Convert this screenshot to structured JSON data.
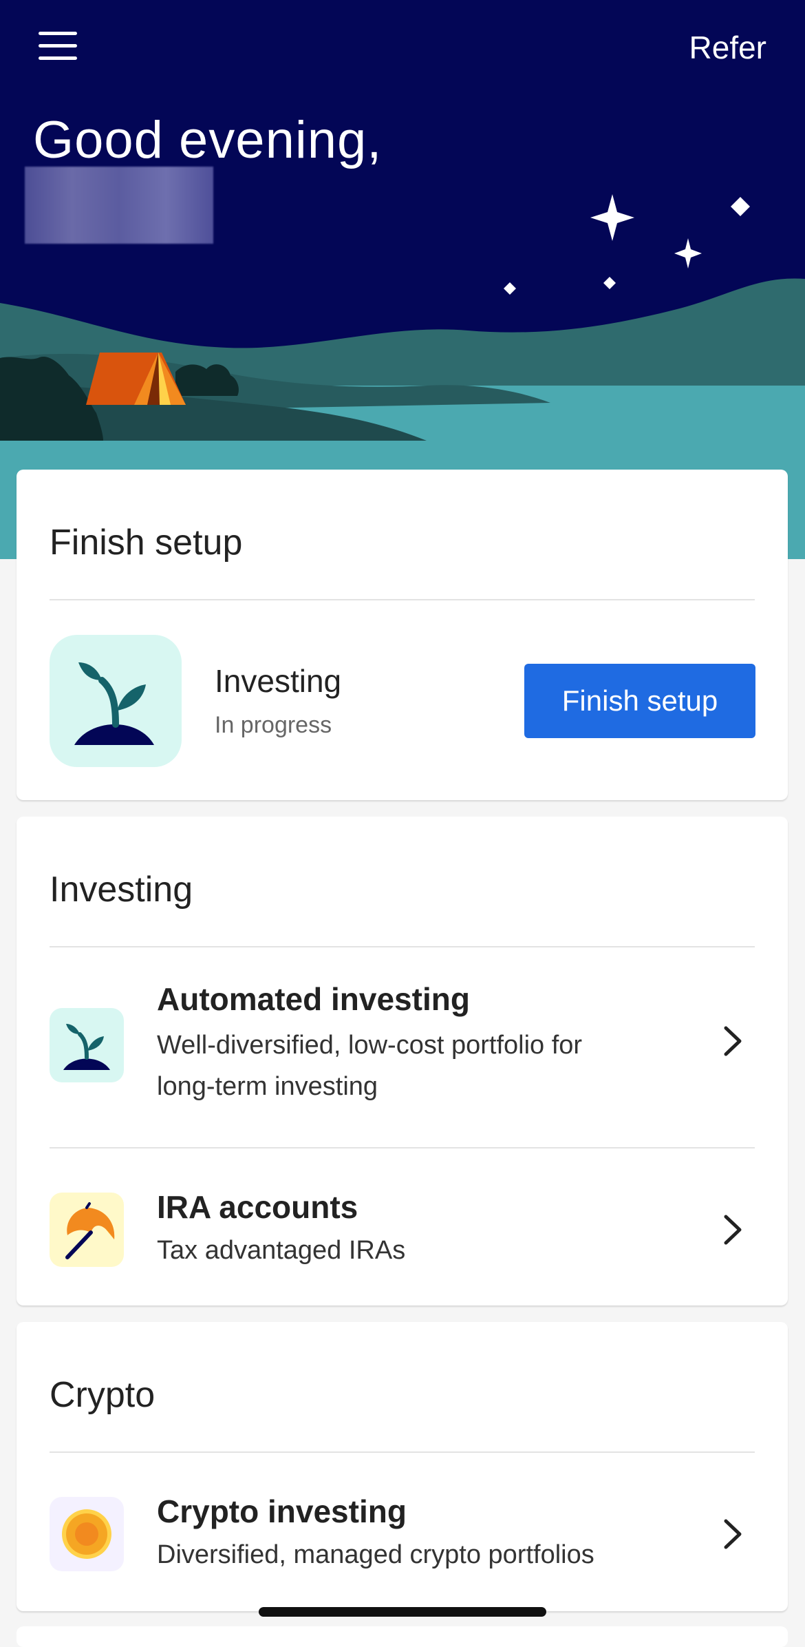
{
  "header": {
    "menu_icon": "hamburger-menu-icon",
    "refer_label": "Refer",
    "greeting": "Good evening,",
    "colors": {
      "sky": "#030656",
      "water": "#4ba9b0",
      "hills": "#2f6b6e",
      "tent": "#d9540d"
    }
  },
  "finish_setup": {
    "title": "Finish setup",
    "item_name": "Investing",
    "item_status": "In progress",
    "button_label": "Finish setup",
    "icon": "sprout-icon",
    "accent": "#1f6be2"
  },
  "investing": {
    "title": "Investing",
    "items": [
      {
        "title": "Automated investing",
        "desc_line1": "Well-diversified, low-cost portfolio for",
        "desc_line2": "long-term investing",
        "icon": "sprout-icon"
      },
      {
        "title": "IRA accounts",
        "desc": "Tax advantaged IRAs",
        "icon": "umbrella-icon"
      }
    ]
  },
  "crypto": {
    "title": "Crypto",
    "items": [
      {
        "title": "Crypto investing",
        "desc": "Diversified, managed crypto portfolios",
        "icon": "coin-icon"
      }
    ]
  }
}
